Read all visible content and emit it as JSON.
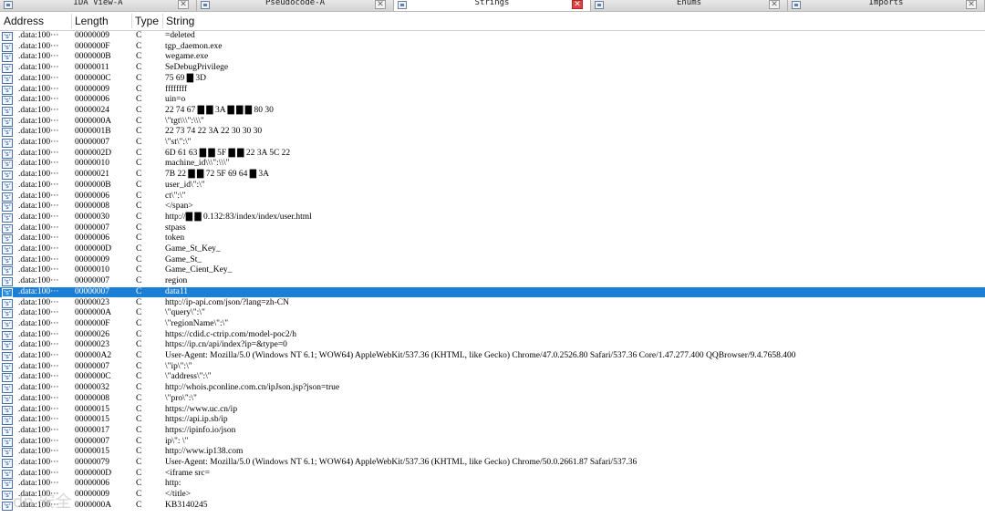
{
  "tabs": [
    {
      "label": "IDA View-A",
      "active": false
    },
    {
      "label": "Pseudocode-A",
      "active": false
    },
    {
      "label": "Strings",
      "active": true
    },
    {
      "label": "Enums",
      "active": false
    },
    {
      "label": "Imports",
      "active": false
    }
  ],
  "columns": {
    "address": "Address",
    "length": "Length",
    "type": "Type",
    "string": "String"
  },
  "selected_row": 24,
  "rows": [
    {
      "address": ".data:100···",
      "length": "00000009",
      "type": "C",
      "string": "=deleted"
    },
    {
      "address": ".data:100···",
      "length": "0000000F",
      "type": "C",
      "string": "tgp_daemon.exe"
    },
    {
      "address": ".data:100···",
      "length": "0000000B",
      "type": "C",
      "string": "wegame.exe"
    },
    {
      "address": ".data:100···",
      "length": "00000011",
      "type": "C",
      "string": "SeDebugPrivilege"
    },
    {
      "address": ".data:100···",
      "length": "0000000C",
      "type": "C",
      "string": "75 69 ▇ 3D"
    },
    {
      "address": ".data:100···",
      "length": "00000009",
      "type": "C",
      "string": "ffffffff"
    },
    {
      "address": ".data:100···",
      "length": "00000006",
      "type": "C",
      "string": "uin=o"
    },
    {
      "address": ".data:100···",
      "length": "00000024",
      "type": "C",
      "string": "22 74 67 ▇ ▇ 3A ▇ ▇ ▇ 80 30"
    },
    {
      "address": ".data:100···",
      "length": "0000000A",
      "type": "C",
      "string": "\\\"tgt\\\\\\\":\\\\\\\""
    },
    {
      "address": ".data:100···",
      "length": "0000001B",
      "type": "C",
      "string": "22 73 74 22 3A 22 30 30 30"
    },
    {
      "address": ".data:100···",
      "length": "00000007",
      "type": "C",
      "string": "\\\"st\\\":\\\""
    },
    {
      "address": ".data:100···",
      "length": "0000002D",
      "type": "C",
      "string": "6D 61 63 ▇ ▇ 5F ▇ ▇ 22 3A 5C 22"
    },
    {
      "address": ".data:100···",
      "length": "00000010",
      "type": "C",
      "string": "machine_id\\\\\\\":\\\\\\\""
    },
    {
      "address": ".data:100···",
      "length": "00000021",
      "type": "C",
      "string": "7B 22 ▇ ▇ 72 5F 69 64 ▇ 3A"
    },
    {
      "address": ".data:100···",
      "length": "0000000B",
      "type": "C",
      "string": "user_id\\\":\\\""
    },
    {
      "address": ".data:100···",
      "length": "00000006",
      "type": "C",
      "string": "ct\\\":\\\""
    },
    {
      "address": ".data:100···",
      "length": "00000008",
      "type": "C",
      "string": "</span>"
    },
    {
      "address": ".data:100···",
      "length": "00000030",
      "type": "C",
      "string": "http://▇ ▇ 0.132:83/index/index/user.html"
    },
    {
      "address": ".data:100···",
      "length": "00000007",
      "type": "C",
      "string": "stpass"
    },
    {
      "address": ".data:100···",
      "length": "00000006",
      "type": "C",
      "string": "token"
    },
    {
      "address": ".data:100···",
      "length": "0000000D",
      "type": "C",
      "string": "Game_St_Key_"
    },
    {
      "address": ".data:100···",
      "length": "00000009",
      "type": "C",
      "string": "Game_St_"
    },
    {
      "address": ".data:100···",
      "length": "00000010",
      "type": "C",
      "string": "Game_Cient_Key_"
    },
    {
      "address": ".data:100···",
      "length": "00000007",
      "type": "C",
      "string": "region"
    },
    {
      "address": ".data:100···",
      "length": "00000007",
      "type": "C",
      "string": "data11"
    },
    {
      "address": ".data:100···",
      "length": "00000023",
      "type": "C",
      "string": "http://ip-api.com/json/?lang=zh-CN"
    },
    {
      "address": ".data:100···",
      "length": "0000000A",
      "type": "C",
      "string": "\\\"query\\\":\\\""
    },
    {
      "address": ".data:100···",
      "length": "0000000F",
      "type": "C",
      "string": "\\\"regionName\\\":\\\""
    },
    {
      "address": ".data:100···",
      "length": "00000026",
      "type": "C",
      "string": "https://cdid.c-ctrip.com/model-poc2/h"
    },
    {
      "address": ".data:100···",
      "length": "00000023",
      "type": "C",
      "string": "https://ip.cn/api/index?ip=&type=0"
    },
    {
      "address": ".data:100···",
      "length": "000000A2",
      "type": "C",
      "string": "User-Agent: Mozilla/5.0 (Windows NT 6.1; WOW64) AppleWebKit/537.36 (KHTML, like Gecko) Chrome/47.0.2526.80 Safari/537.36 Core/1.47.277.400 QQBrowser/9.4.7658.400"
    },
    {
      "address": ".data:100···",
      "length": "00000007",
      "type": "C",
      "string": "\\\"ip\\\":\\\""
    },
    {
      "address": ".data:100···",
      "length": "0000000C",
      "type": "C",
      "string": "\\\"address\\\":\\\""
    },
    {
      "address": ".data:100···",
      "length": "00000032",
      "type": "C",
      "string": "http://whois.pconline.com.cn/ipJson.jsp?json=true"
    },
    {
      "address": ".data:100···",
      "length": "00000008",
      "type": "C",
      "string": "\\\"pro\\\":\\\""
    },
    {
      "address": ".data:100···",
      "length": "00000015",
      "type": "C",
      "string": "https://www.uc.cn/ip"
    },
    {
      "address": ".data:100···",
      "length": "00000015",
      "type": "C",
      "string": "https://api.ip.sb/ip"
    },
    {
      "address": ".data:100···",
      "length": "00000017",
      "type": "C",
      "string": "https://ipinfo.io/json"
    },
    {
      "address": ".data:100···",
      "length": "00000007",
      "type": "C",
      "string": "ip\\\": \\\""
    },
    {
      "address": ".data:100···",
      "length": "00000015",
      "type": "C",
      "string": "http://www.ip138.com"
    },
    {
      "address": ".data:100···",
      "length": "00000079",
      "type": "C",
      "string": "User-Agent: Mozilla/5.0 (Windows NT 6.1; WOW64) AppleWebKit/537.36 (KHTML, like Gecko) Chrome/50.0.2661.87 Safari/537.36"
    },
    {
      "address": ".data:100···",
      "length": "0000000D",
      "type": "C",
      "string": "<iframe src="
    },
    {
      "address": ".data:100···",
      "length": "00000006",
      "type": "C",
      "string": "http:"
    },
    {
      "address": ".data:100···",
      "length": "00000009",
      "type": "C",
      "string": "</title>"
    },
    {
      "address": ".data:100···",
      "length": "0000000A",
      "type": "C",
      "string": "KB3140245"
    }
  ],
  "watermark": "dn 安全"
}
